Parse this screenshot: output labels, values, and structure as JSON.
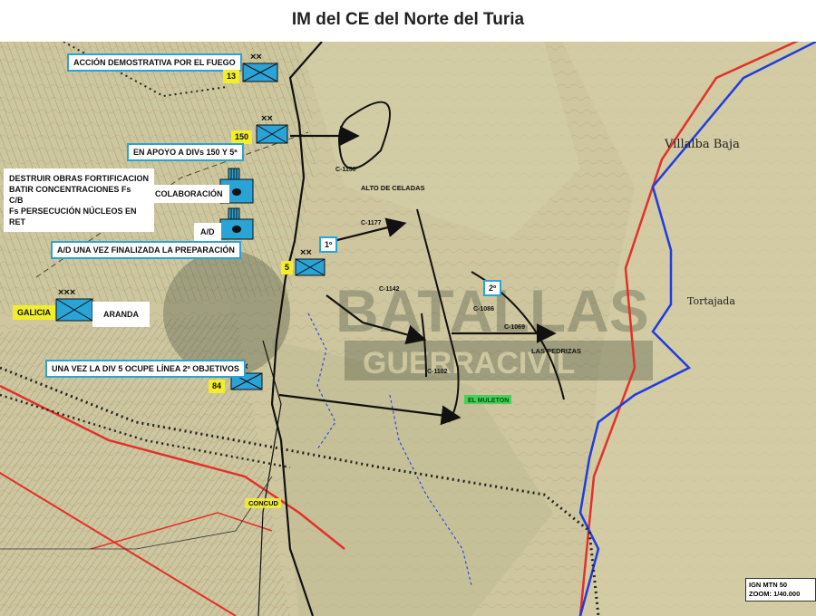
{
  "title": "IM del CE del Norte del Turia",
  "labels": {
    "accion": "ACCIÓN DEMOSTRATIVA POR EL FUEGO",
    "apoyo": "EN APOYO A DIVs 150 Y 5ª",
    "destruir1": "DESTRUIR OBRAS FORTIFICACION",
    "destruir2": "BATIR CONCENTRACIONES Fs",
    "destruir3": "C/B",
    "destruir4": "Fs PERSECUCIÓN NÚCLEOS EN RET",
    "colaboracion": "COLABORACIÓN",
    "ad": "A/D",
    "ad_prep": "A/D UNA VEZ FINALIZADA LA PREPARACIÓN",
    "una_vez": "UNA VEZ LA DIV 5 OCUPE LÍNEA  2º OBJETIVOS",
    "aranda": "ARANDA",
    "galicia": "GALICIA"
  },
  "units": {
    "u13": "13",
    "u150": "150",
    "u5": "5",
    "u84": "84"
  },
  "objectives": {
    "obj1": "1º",
    "obj2": "2º"
  },
  "map_places": {
    "alto_celadas": "ALTO DE CELADAS",
    "las_pedrizas": "LAS PEDRIZAS",
    "el_muleton": "EL MULETON",
    "concud": "CONCUD",
    "villalba": "Villalba Baja",
    "tortajada": "Tortajada",
    "c1177": "C-1177",
    "c1142": "C-1142",
    "c1069": "C-1069",
    "c1086": "C-1086",
    "c1102": "C-1102",
    "c1150": "C-1150"
  },
  "watermark": {
    "line1": "BATALLAS",
    "line2": "GUERRACIVIL"
  },
  "scale": {
    "line1": "IGN MTN 50",
    "line2": "ZOOM: 1/40.000"
  },
  "colors": {
    "unit_fill": "#2aa3d6",
    "label_border": "#2aa3d6",
    "highlight": "#f2ee2b",
    "road": "#e2312a",
    "river": "#1f3ce0",
    "map_base": "#c9c49d"
  }
}
